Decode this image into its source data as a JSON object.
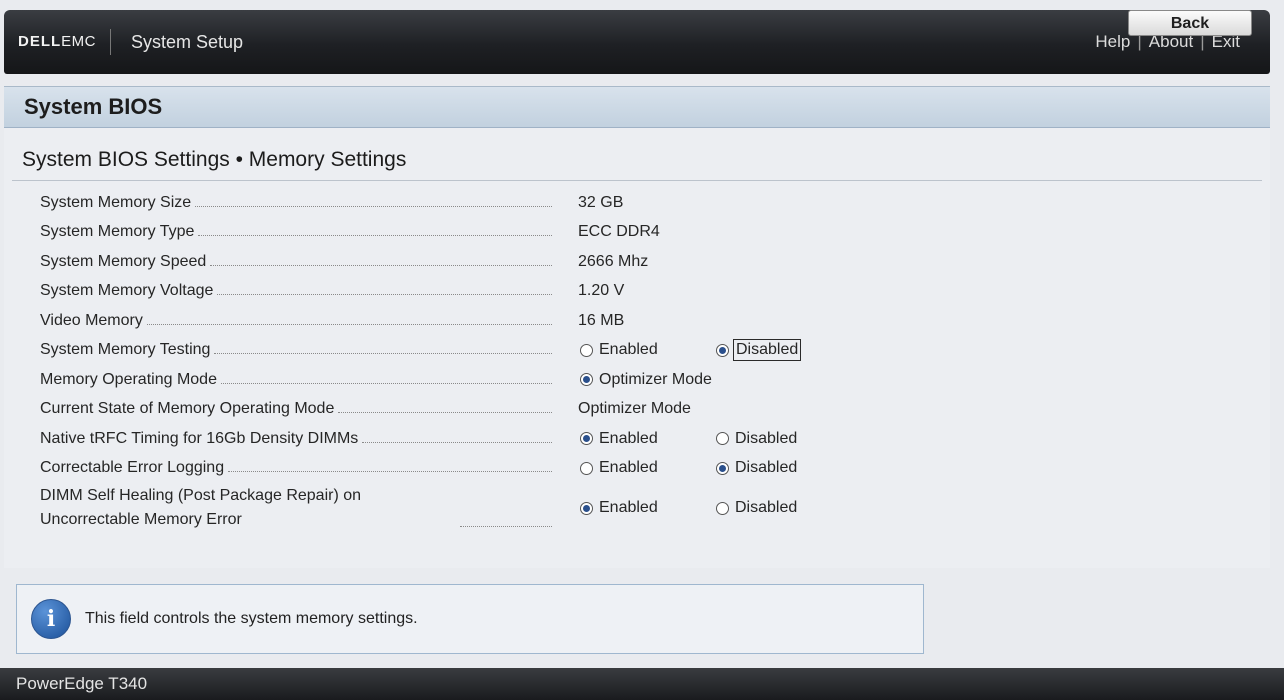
{
  "header": {
    "logo_dell": "DELL",
    "logo_emc": "EMC",
    "title": "System Setup",
    "links": {
      "help": "Help",
      "about": "About",
      "exit": "Exit",
      "separator": "|"
    }
  },
  "section": {
    "title": "System BIOS"
  },
  "page": {
    "subtitle": "System BIOS Settings • Memory Settings"
  },
  "settings": [
    {
      "label": "System Memory Size",
      "value": "32 GB"
    },
    {
      "label": "System Memory Type",
      "value": "ECC DDR4"
    },
    {
      "label": "System Memory Speed",
      "value": "2666 Mhz"
    },
    {
      "label": "System Memory Voltage",
      "value": "1.20 V"
    },
    {
      "label": "Video Memory",
      "value": "16 MB"
    },
    {
      "label": "System Memory Testing",
      "options": [
        "Enabled",
        "Disabled"
      ],
      "selected": "Disabled"
    },
    {
      "label": "Memory Operating Mode",
      "options": [
        "Optimizer Mode"
      ],
      "selected": "Optimizer Mode"
    },
    {
      "label": "Current State of Memory Operating Mode",
      "value": "Optimizer Mode"
    },
    {
      "label": "Native tRFC Timing for 16Gb Density DIMMs",
      "options": [
        "Enabled",
        "Disabled"
      ],
      "selected": "Enabled"
    },
    {
      "label": "Correctable Error Logging",
      "options": [
        "Enabled",
        "Disabled"
      ],
      "selected": "Disabled"
    },
    {
      "label": "DIMM Self Healing (Post Package Repair) on Uncorrectable Memory Error",
      "options": [
        "Enabled",
        "Disabled"
      ],
      "selected": "Enabled"
    }
  ],
  "help": {
    "text": "This field controls the system memory settings.",
    "icon": "info-icon",
    "icon_glyph": "i"
  },
  "footer": {
    "model": "PowerEdge T340",
    "back_label": "Back"
  }
}
